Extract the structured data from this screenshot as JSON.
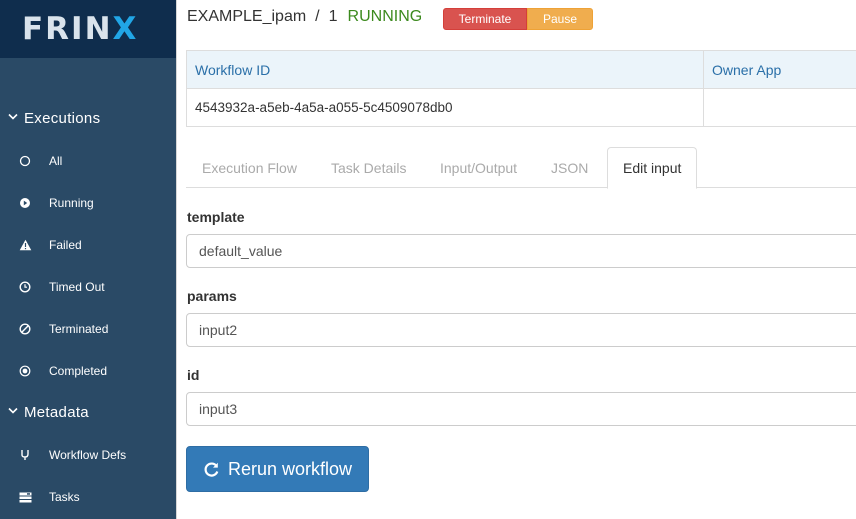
{
  "brand": {
    "logo_main": "FRIN",
    "logo_accent": "X",
    "accent_color": "#21a6e6"
  },
  "sidebar": {
    "executions_label": "Executions",
    "executions_items": [
      {
        "label": "All",
        "icon": "circle-outline-icon"
      },
      {
        "label": "Running",
        "icon": "play-circle-icon"
      },
      {
        "label": "Failed",
        "icon": "warning-icon"
      },
      {
        "label": "Timed Out",
        "icon": "clock-icon"
      },
      {
        "label": "Terminated",
        "icon": "ban-icon"
      },
      {
        "label": "Completed",
        "icon": "target-icon"
      }
    ],
    "metadata_label": "Metadata",
    "metadata_items": [
      {
        "label": "Workflow Defs",
        "icon": "fork-icon"
      },
      {
        "label": "Tasks",
        "icon": "tasks-icon"
      }
    ]
  },
  "header": {
    "workflow_name": "EXAMPLE_ipam",
    "separator": "/",
    "version": "1",
    "status": "RUNNING",
    "status_color": "#3c8a1e",
    "terminate_label": "Terminate",
    "pause_label": "Pause"
  },
  "info_table": {
    "headers": [
      "Workflow ID",
      "Owner App"
    ],
    "row": [
      "4543932a-a5eb-4a5a-a055-5c4509078db0",
      ""
    ]
  },
  "tabs": [
    {
      "label": "Execution Flow",
      "active": false
    },
    {
      "label": "Task Details",
      "active": false
    },
    {
      "label": "Input/Output",
      "active": false
    },
    {
      "label": "JSON",
      "active": false
    },
    {
      "label": "Edit input",
      "active": true
    }
  ],
  "form": {
    "fields": [
      {
        "label": "template",
        "value": "default_value"
      },
      {
        "label": "params",
        "value": "input2"
      },
      {
        "label": "id",
        "value": "input3"
      }
    ],
    "rerun_label": "Rerun workflow"
  }
}
